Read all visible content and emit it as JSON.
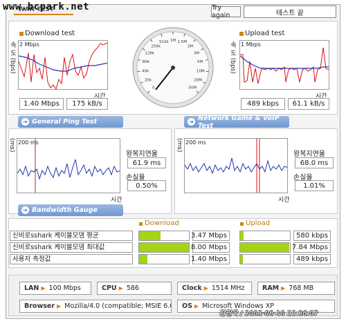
{
  "watermark": "www.bcpark.net",
  "header": {
    "tab": "WAN TEST",
    "try_again": "Try again",
    "status": "테스트 끝"
  },
  "download": {
    "title": "Download test",
    "ylabel": "속 도 (bps)",
    "scale": "2 Mbps",
    "xlabel": "시간",
    "speed_mbps": "1.40 Mbps",
    "speed_kbs": "175 kB/s"
  },
  "upload": {
    "title": "Upload test",
    "ylabel": "속 도 (bps)",
    "scale": "1 Mbps",
    "xlabel": "시간",
    "speed_kbps": "489 kbps",
    "speed_kbs": "61.1 kB/s"
  },
  "gauge": {
    "ticks": [
      "0",
      "20k",
      "40k",
      "80k",
      "128k",
      "256k",
      "512k",
      "1M",
      "1.5M",
      "2M",
      "3M",
      "5M",
      "10M",
      "20M",
      "50M"
    ]
  },
  "ping": {
    "section": "General Ping Test",
    "ylabel": "(ms)",
    "scale": "200 ms",
    "xlabel": "시간",
    "rtt_label": "왕복지연율",
    "rtt": "61.9 ms",
    "loss_label": "손실율",
    "loss": "0.50%"
  },
  "game": {
    "section": "Network Game & VoIP Test",
    "ylabel": "(ms)",
    "scale": "200 ms",
    "xlabel": "시간",
    "rtt_label": "왕복지연율",
    "rtt": "68.0 ms",
    "loss_label": "손실율",
    "loss": "1.01%"
  },
  "bandwidth": {
    "section": "Bandwidth Gauge",
    "download_header": "Download",
    "upload_header": "Upload",
    "rows": [
      {
        "label": "신비로sshark 케이블모뎀 평균",
        "down": "3.47 Mbps",
        "down_pct": 0.43,
        "up": "580 kbps",
        "up_pct": 0.07
      },
      {
        "label": "신비로sshark 케이블모뎀 최대값",
        "down": "8.00 Mbps",
        "down_pct": 1.0,
        "up": "7.84 Mbps",
        "up_pct": 0.98
      },
      {
        "label": "사용자 측정값",
        "down": "1.40 Mbps",
        "down_pct": 0.17,
        "up": "489 kbps",
        "up_pct": 0.06
      }
    ]
  },
  "system": {
    "lan_label": "LAN",
    "lan": "100 Mbps",
    "cpu_label": "CPU",
    "cpu": "586",
    "clock_label": "Clock",
    "clock": "1514 MHz",
    "ram_label": "RAM",
    "ram": "768 MB",
    "browser_label": "Browser",
    "browser": "Mozilla/4.0 (compatible; MSIE 6.0",
    "os_label": "OS",
    "os": "Microsoft Windows XP"
  },
  "footer": "정필욱 / 2003-08-10 22:56:07",
  "colors": {
    "bar": "#a4d416",
    "accent": "#d08818",
    "section": "#6f97d0",
    "series_red": "#dd1111",
    "series_blue": "#2233aa"
  }
}
